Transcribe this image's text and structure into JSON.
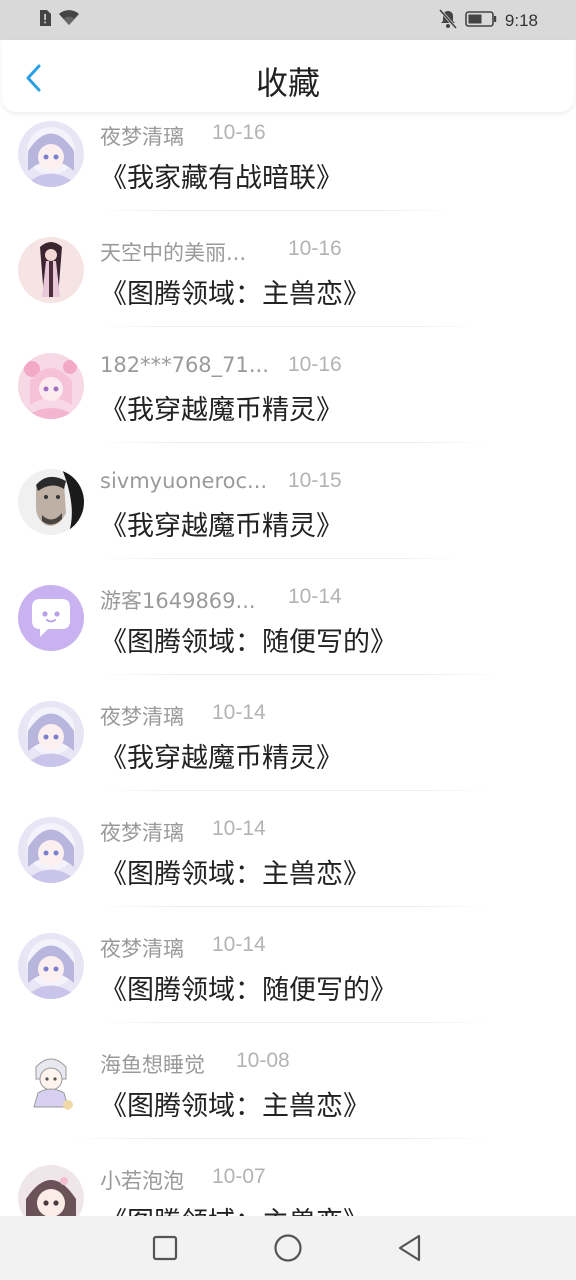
{
  "status_bar": {
    "time": "9:18",
    "icons": [
      "alert-sim-icon",
      "wifi-icon",
      "bell-muted-icon",
      "battery-icon"
    ]
  },
  "header": {
    "title": "收藏",
    "back_icon": "chevron-left-icon",
    "accent_color": "#2b9fe3"
  },
  "favorites": [
    {
      "user": "夜梦清璃",
      "date": "10-16",
      "book": "《我家藏有战暗联》",
      "avatar": "anime-girl-white"
    },
    {
      "user": "天空中的美丽...",
      "date": "10-16",
      "book": "《图腾领域：主兽恋》",
      "avatar": "anime-girl-dark-hair"
    },
    {
      "user": "182***768_71...",
      "date": "10-16",
      "book": "《我穿越魔币精灵》",
      "avatar": "anime-girl-pink"
    },
    {
      "user": "sivmyuoneroc...",
      "date": "10-15",
      "book": "《我穿越魔币精灵》",
      "avatar": "man-photo"
    },
    {
      "user": "游客1649869...",
      "date": "10-14",
      "book": "《图腾领域：随便写的》",
      "avatar": "default-chat-bubble"
    },
    {
      "user": "夜梦清璃",
      "date": "10-14",
      "book": "《我穿越魔币精灵》",
      "avatar": "anime-girl-white"
    },
    {
      "user": "夜梦清璃",
      "date": "10-14",
      "book": "《图腾领域：主兽恋》",
      "avatar": "anime-girl-white"
    },
    {
      "user": "夜梦清璃",
      "date": "10-14",
      "book": "《图腾领域：随便写的》",
      "avatar": "anime-girl-white"
    },
    {
      "user": "海鱼想睡觉",
      "date": "10-08",
      "book": "《图腾领域：主兽恋》",
      "avatar": "chibi-boy"
    },
    {
      "user": "小若泡泡",
      "date": "10-07",
      "book": "《图腾领域：主兽恋》",
      "avatar": "anime-girl-brown"
    }
  ],
  "nav_bar": {
    "buttons": [
      "recent-apps-icon",
      "home-icon",
      "back-triangle-icon"
    ]
  }
}
